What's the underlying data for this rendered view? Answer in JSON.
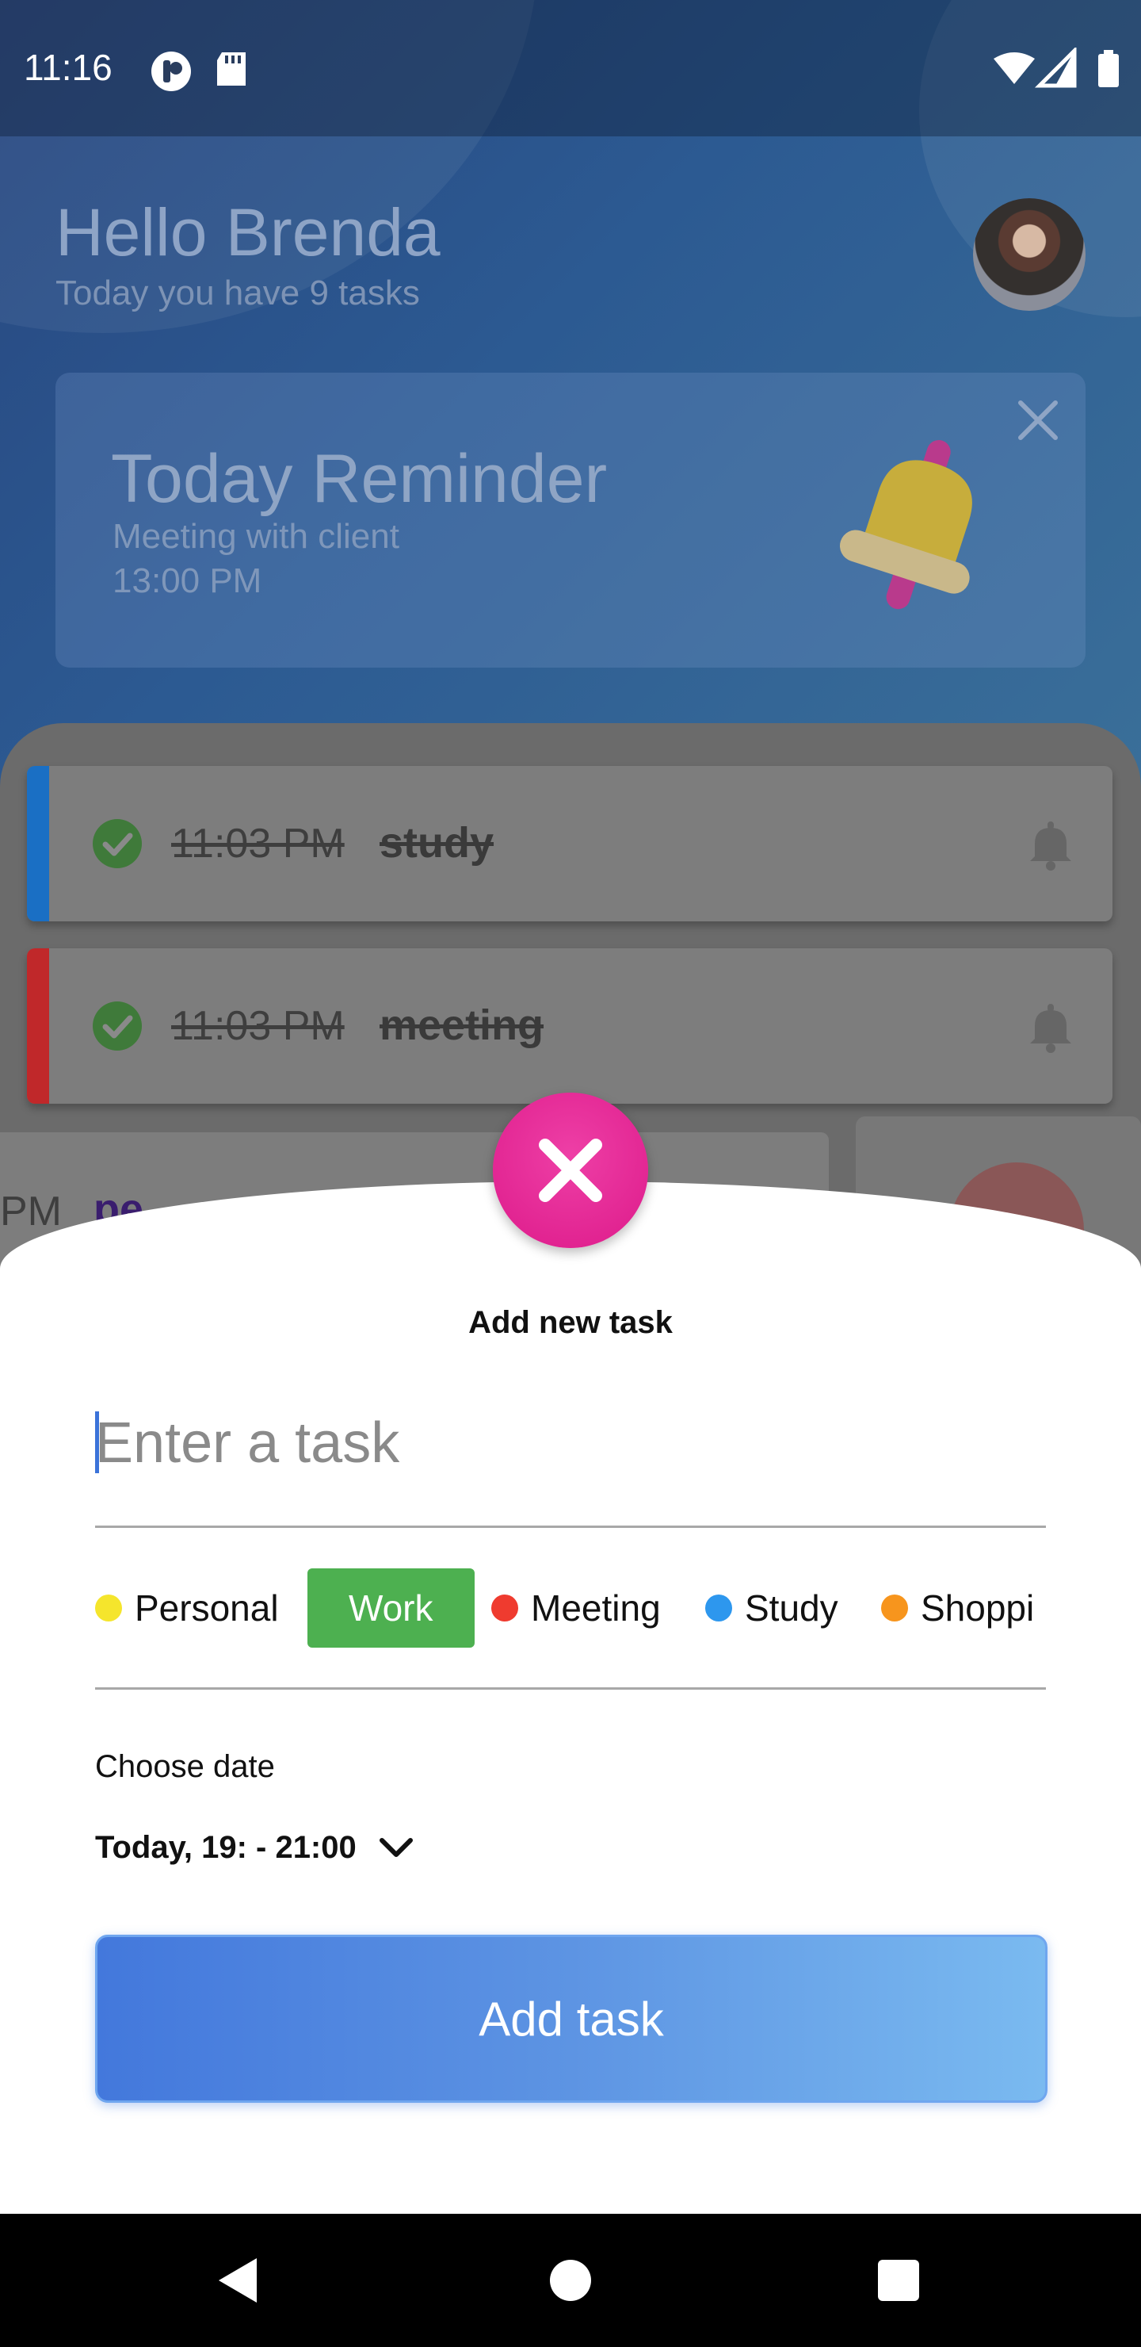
{
  "status_bar": {
    "time": "11:16"
  },
  "header": {
    "greeting": "Hello Brenda",
    "subtitle": "Today you have 9 tasks"
  },
  "reminder": {
    "title": "Today Reminder",
    "subtitle": "Meeting with client",
    "time": "13:00 PM"
  },
  "tasks": [
    {
      "time": "11:03 PM",
      "name": "study",
      "color": "#1a6fc4",
      "done": true
    },
    {
      "time": "11:03 PM",
      "name": "meeting",
      "color": "#c0282a",
      "done": true
    },
    {
      "time": "PM",
      "name": "pe",
      "done": false
    }
  ],
  "sheet": {
    "title": "Add new task",
    "input_placeholder": "Enter a task",
    "categories": [
      {
        "label": "Personal",
        "color": "#f5e52c"
      },
      {
        "label": "Work",
        "color": "#4db050",
        "selected": true
      },
      {
        "label": "Meeting",
        "color": "#ef3b2f"
      },
      {
        "label": "Study",
        "color": "#2d97ee"
      },
      {
        "label": "Shoppi",
        "color": "#f7951d"
      }
    ],
    "date_label": "Choose date",
    "date_value": "Today, 19: - 21:00",
    "add_button": "Add task"
  },
  "colors": {
    "accent": "#dd1a8a",
    "button_start": "#4378dc",
    "button_end": "#7abaf0"
  }
}
